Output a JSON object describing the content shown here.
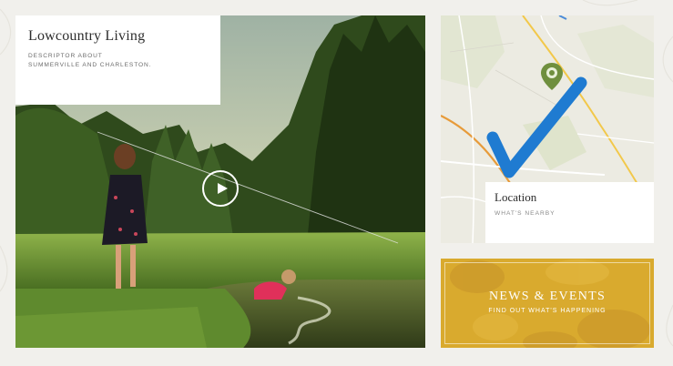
{
  "video": {
    "title": "Lowcountry Living",
    "description": "Descriptor about Summerville and Charleston.",
    "play_icon": "play-icon"
  },
  "map": {
    "title": "Location",
    "subtitle": "What's Nearby",
    "pin_icon": "map-pin-icon",
    "check_icon": "checkmark-icon",
    "check_color": "#1f7bd1",
    "pin_color": "#6f8f3e"
  },
  "news": {
    "title": "News & Events",
    "subtitle": "Find out what's happening",
    "accent": "#d9aa2e"
  }
}
